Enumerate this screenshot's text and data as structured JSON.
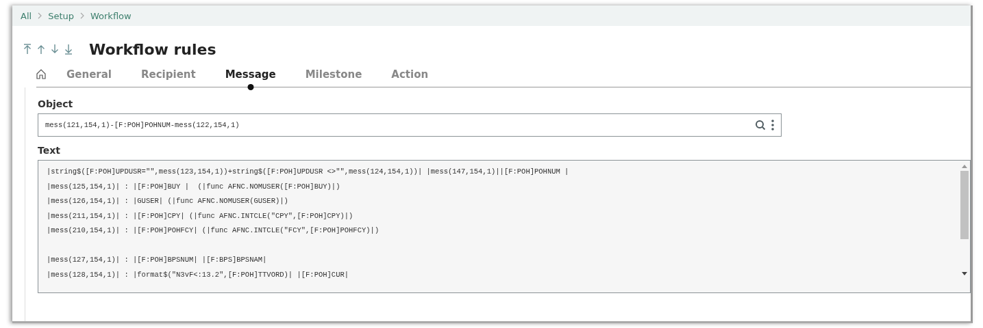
{
  "breadcrumb": [
    "All",
    "Setup",
    "Workflow"
  ],
  "title": "Workflow rules",
  "tabs": [
    {
      "label": "General",
      "selected": false
    },
    {
      "label": "Recipient",
      "selected": false
    },
    {
      "label": "Message",
      "selected": true
    },
    {
      "label": "Milestone",
      "selected": false
    },
    {
      "label": "Action",
      "selected": false
    }
  ],
  "object_field": {
    "label": "Object",
    "value": "mess(121,154,1)-[F:POH]POHNUM-mess(122,154,1)"
  },
  "text_field": {
    "label": "Text",
    "paragraphs": [
      [
        "|string$([F:POH]UPDUSR=\"\",mess(123,154,1))+string$([F:POH]UPDUSR <>\"\",mess(124,154,1))| |mess(147,154,1)||[F:POH]POHNUM |",
        "|mess(125,154,1)| : |[F:POH]BUY |  (|func AFNC.NOMUSER([F:POH]BUY)|)",
        "|mess(126,154,1)| : |GUSER| (|func AFNC.NOMUSER(GUSER)|)",
        "|mess(211,154,1)| : |[F:POH]CPY| (|func AFNC.INTCLE(\"CPY\",[F:POH]CPY)|)",
        "|mess(210,154,1)| : |[F:POH]POHFCY| (|func AFNC.INTCLE(\"FCY\",[F:POH]POHFCY)|)"
      ],
      [
        "|mess(127,154,1)| : |[F:POH]BPSNUM| |[F:BPS]BPSNAM|",
        "|mess(128,154,1)| : |format$(\"N3vF<:13.2\",[F:POH]TTVORD)| |[F:POH]CUR|"
      ]
    ]
  }
}
